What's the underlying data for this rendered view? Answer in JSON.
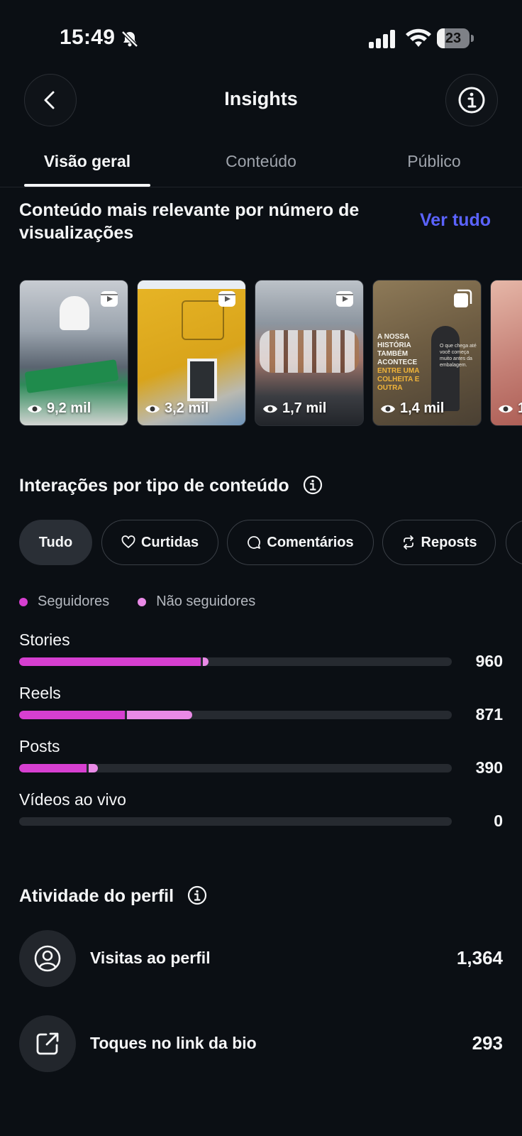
{
  "status_bar": {
    "time": "15:49",
    "battery_level": "23"
  },
  "header": {
    "title": "Insights",
    "back_icon": "chevron-left-icon",
    "info_icon": "info-icon"
  },
  "tabs": [
    {
      "label": "Visão geral",
      "active": true
    },
    {
      "label": "Conteúdo",
      "active": false
    },
    {
      "label": "Público",
      "active": false
    }
  ],
  "top_content": {
    "title": "Conteúdo mais relevante por número de visualizações",
    "see_all": "Ver tudo",
    "items": [
      {
        "type_icon": "reel-icon",
        "views": "9,2 mil"
      },
      {
        "type_icon": "reel-icon",
        "views": "3,2 mil"
      },
      {
        "type_icon": "reel-icon",
        "views": "1,7 mil"
      },
      {
        "type_icon": "carousel-icon",
        "views": "1,4 mil",
        "text_main_1": "A nossa história",
        "text_main_2": "também acontece",
        "text_highlight": "entre uma colheita e outra",
        "text_small": "O que chega até você começa muito antes da embalagem."
      },
      {
        "type_icon": "reel-icon",
        "views": "1"
      }
    ]
  },
  "interactions": {
    "title": "Interações por tipo de conteúdo",
    "filters": [
      {
        "label": "Tudo",
        "active": true,
        "icon": ""
      },
      {
        "label": "Curtidas",
        "active": false,
        "icon": "heart-icon"
      },
      {
        "label": "Comentários",
        "active": false,
        "icon": "comment-icon"
      },
      {
        "label": "Reposts",
        "active": false,
        "icon": "repost-icon"
      },
      {
        "label": "",
        "active": false,
        "icon": ""
      }
    ],
    "legend": [
      {
        "label": "Seguidores",
        "color": "#d63fd0"
      },
      {
        "label": "Não seguidores",
        "color": "#e98ae6"
      }
    ],
    "rows": [
      {
        "label": "Stories",
        "value": "960",
        "followers_fraction": 0.42,
        "non_followers_fraction": 0.013
      },
      {
        "label": "Reels",
        "value": "871",
        "followers_fraction": 0.245,
        "non_followers_fraction": 0.15
      },
      {
        "label": "Posts",
        "value": "390",
        "followers_fraction": 0.155,
        "non_followers_fraction": 0.022
      },
      {
        "label": "Vídeos ao vivo",
        "value": "0",
        "followers_fraction": 0,
        "non_followers_fraction": 0
      }
    ]
  },
  "profile_activity": {
    "title": "Atividade do perfil",
    "rows": [
      {
        "icon": "profile-icon",
        "label": "Visitas ao perfil",
        "value": "1,364"
      },
      {
        "icon": "external-link-icon",
        "label": "Toques no link da bio",
        "value": "293"
      }
    ]
  }
}
